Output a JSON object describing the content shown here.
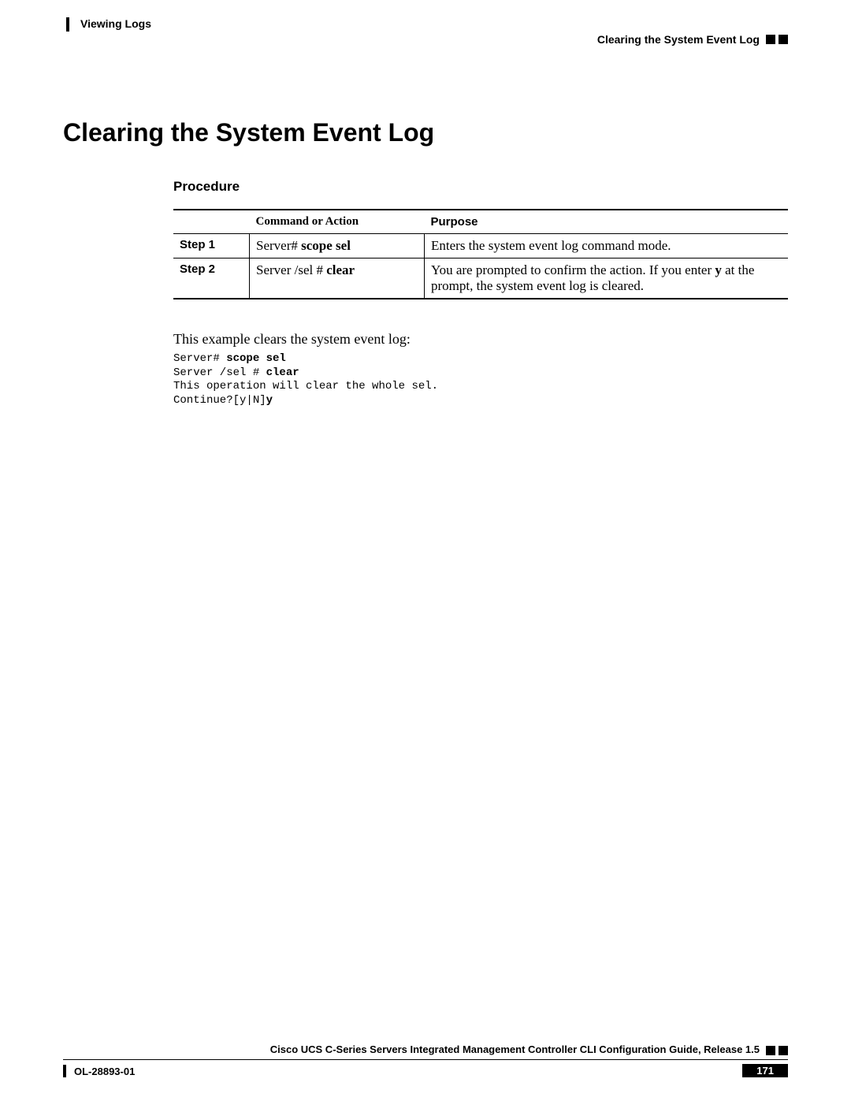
{
  "header": {
    "left": "Viewing Logs",
    "right": "Clearing the System Event Log"
  },
  "title": "Clearing the System Event Log",
  "procedure": {
    "label": "Procedure",
    "columns": {
      "step": "",
      "command": "Command or Action",
      "purpose": "Purpose"
    },
    "rows": [
      {
        "step": "Step 1",
        "prompt": "Server#",
        "cmd": "scope sel",
        "purpose_before": "Enters the system event log command mode.",
        "purpose_bold": "",
        "purpose_after": ""
      },
      {
        "step": "Step 2",
        "prompt": "Server /sel #",
        "cmd": "clear",
        "purpose_before": "You are prompted to confirm the action. If you enter ",
        "purpose_bold": "y",
        "purpose_after": " at the prompt, the system event log is cleared."
      }
    ]
  },
  "example": {
    "intro": "This example clears the system event log:",
    "lines": [
      {
        "plain": "Server# ",
        "bold": "scope sel",
        "tail": ""
      },
      {
        "plain": "Server /sel # ",
        "bold": "clear",
        "tail": ""
      },
      {
        "plain": "This operation will clear the whole sel.",
        "bold": "",
        "tail": ""
      },
      {
        "plain": "Continue?[y|N]",
        "bold": "y",
        "tail": ""
      }
    ]
  },
  "footer": {
    "guide": "Cisco UCS C-Series Servers Integrated Management Controller CLI Configuration Guide, Release 1.5",
    "docid": "OL-28893-01",
    "page": "171"
  }
}
